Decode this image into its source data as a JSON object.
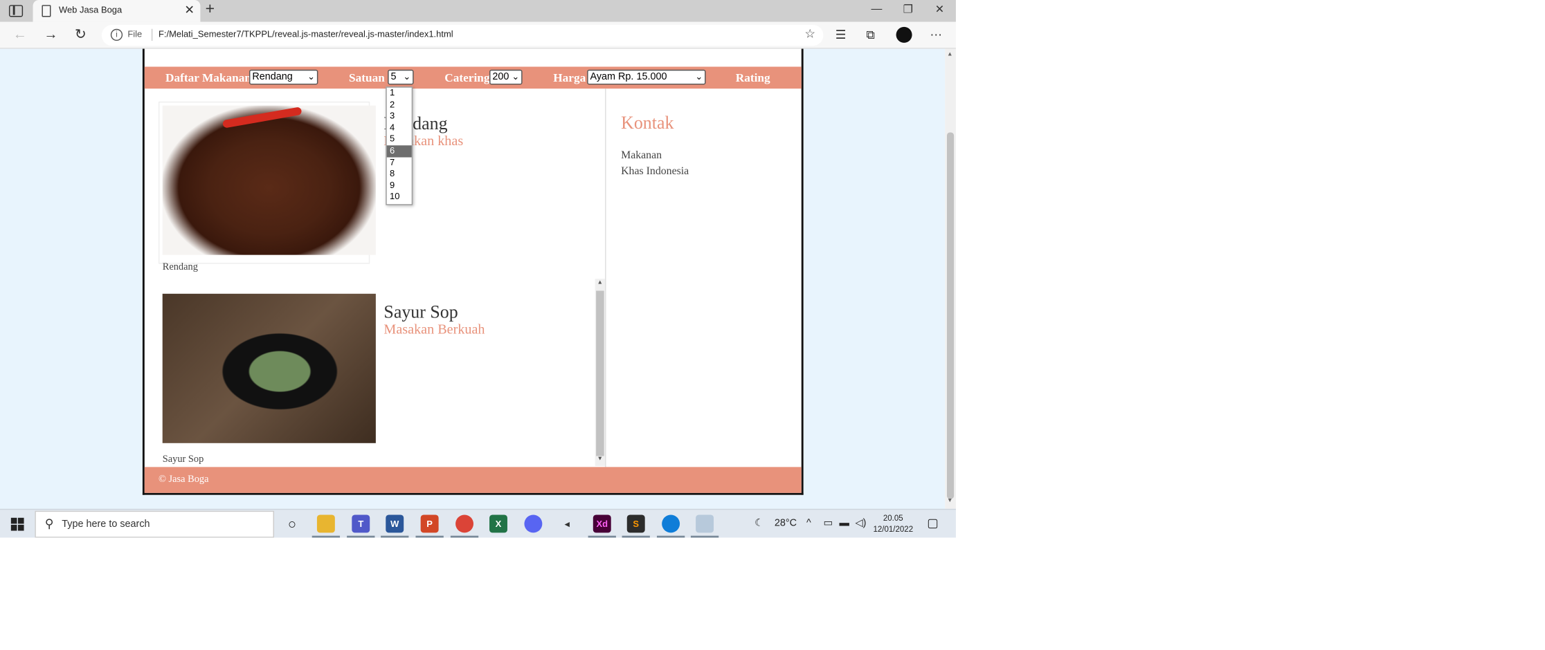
{
  "browser": {
    "tab_title": "Web Jasa Boga",
    "file_label": "File",
    "url": "F:/Melati_Semester7/TKPPL/reveal.js-master/reveal.js-master/index1.html"
  },
  "navbar": {
    "daftar_label": "Daftar Makanan",
    "daftar_value": "Rendang",
    "satuan_label": "Satuan",
    "satuan_value": "5",
    "catering_label": "Catering",
    "catering_value": "200",
    "harga_label": "Harga",
    "harga_value": "Ayam Rp. 15.000",
    "rating_label": "Rating"
  },
  "satuan_options": [
    "1",
    "2",
    "3",
    "4",
    "5",
    "6",
    "7",
    "8",
    "9",
    "10"
  ],
  "satuan_highlighted": "6",
  "items": [
    {
      "name": "Rendang",
      "subtitle": "Masakan khas",
      "caption": "Rendang"
    },
    {
      "name": "Sayur Sop",
      "subtitle": "Masakan Berkuah",
      "caption": "Sayur Sop"
    }
  ],
  "sidebar": {
    "heading": "Kontak",
    "line1": "Makanan",
    "line2": "Khas Indonesia"
  },
  "footer": {
    "text": "© Jasa Boga"
  },
  "taskbar": {
    "search_placeholder": "Type here to search",
    "weather": "28°C",
    "time": "20.05",
    "date": "12/01/2022"
  },
  "colors": {
    "accent": "#e8927b",
    "page_bg": "#e8f4fd"
  }
}
